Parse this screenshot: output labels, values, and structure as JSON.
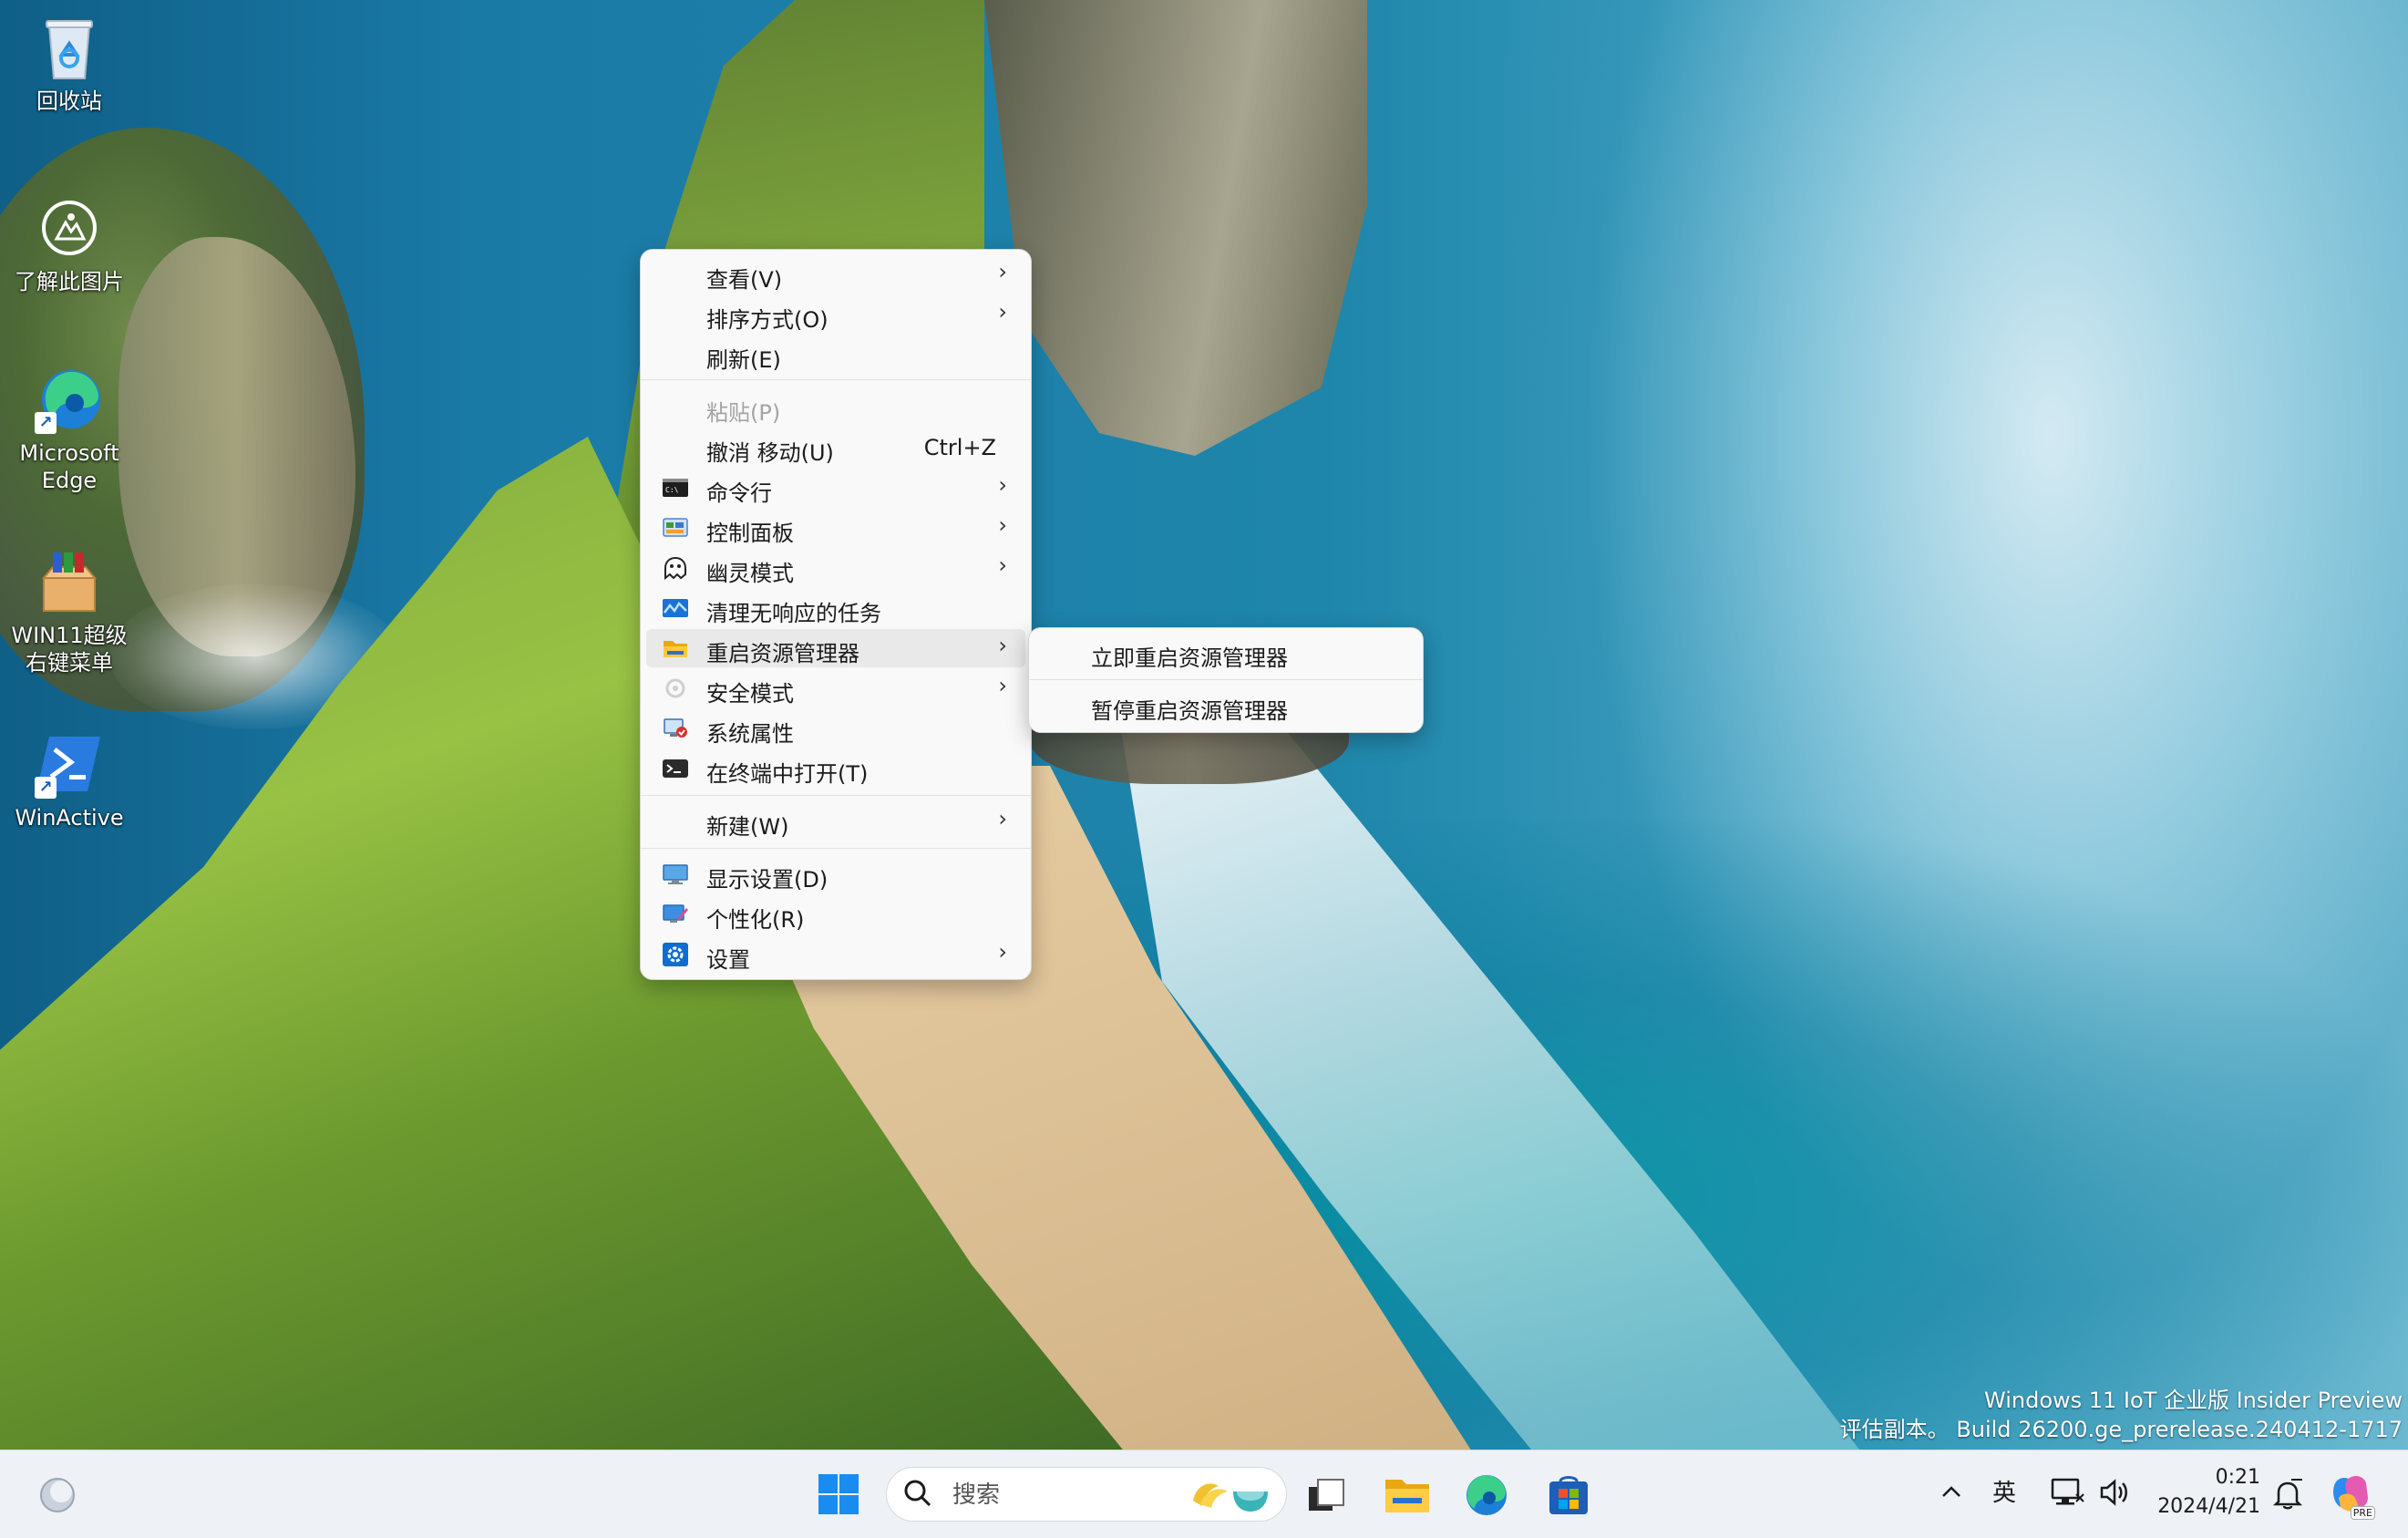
{
  "desktop_icons": [
    {
      "name": "recycle-bin",
      "label": "回收站"
    },
    {
      "name": "learn-about-picture",
      "label": "了解此图片"
    },
    {
      "name": "microsoft-edge",
      "label_line1": "Microsoft",
      "label_line2": "Edge"
    },
    {
      "name": "win11-menu-tool",
      "label_line1": "WIN11超级",
      "label_line2": "右键菜单"
    },
    {
      "name": "winactive",
      "label": "WinActive"
    }
  ],
  "context_menu": {
    "items": {
      "view": "查看(V)",
      "sort": "排序方式(O)",
      "refresh": "刷新(E)",
      "paste": "粘贴(P)",
      "undo": "撤消 移动(U)",
      "undo_shortcut": "Ctrl+Z",
      "cmd": "命令行",
      "control_panel": "控制面板",
      "ghost_mode": "幽灵模式",
      "kill_tasks": "清理无响应的任务",
      "restart_explorer": "重启资源管理器",
      "safe_mode": "安全模式",
      "system_properties": "系统属性",
      "open_terminal": "在终端中打开(T)",
      "new": "新建(W)",
      "display_settings": "显示设置(D)",
      "personalize": "个性化(R)",
      "settings": "设置"
    },
    "arrow": "›"
  },
  "submenu": {
    "items": [
      "立即重启资源管理器",
      "暂停重启资源管理器"
    ]
  },
  "watermark": {
    "line1": "Windows 11 IoT 企业版 Insider Preview",
    "line2": "评估副本。 Build 26200.ge_prerelease.240412-1717"
  },
  "taskbar": {
    "search_placeholder": "搜索",
    "tray_ime": "英",
    "tray_chevron": "^",
    "clock_time": "0:21",
    "clock_date": "2024/4/21",
    "copilot_badge": "PRE"
  },
  "colors": {
    "accent": "#0067c0",
    "menu_bg": "#f9f9f9",
    "taskbar_bg": "#eef1f5"
  }
}
